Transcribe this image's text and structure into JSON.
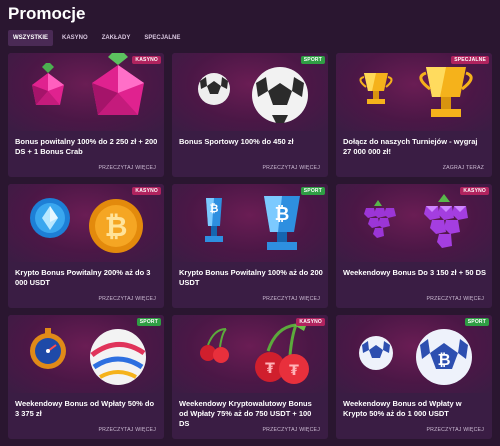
{
  "page": {
    "title": "Promocje"
  },
  "tabs": [
    {
      "label": "WSZYSTKIE",
      "active": true
    },
    {
      "label": "KASYNO",
      "active": false
    },
    {
      "label": "ZAKŁADY",
      "active": false
    },
    {
      "label": "SPECJALNE",
      "active": false
    }
  ],
  "colors": {
    "badge_kasyno": "#b0235e",
    "badge_sport": "#2f9e44",
    "badge_specjalne": "#b0235e"
  },
  "cards": [
    {
      "title": "Bonus powitalny 100% do 2 250 zł + 200 DS + 1 Bonus Crab",
      "badge": "KASYNO",
      "badge_type": "kasyno",
      "link": "PRZECZYTAJ WIĘCEJ",
      "art": "raspberry-icon"
    },
    {
      "title": "Bonus Sportowy 100% do 450 zł",
      "badge": "SPORT",
      "badge_type": "sport",
      "link": "PRZECZYTAJ WIĘCEJ",
      "art": "soccer-ball-icon"
    },
    {
      "title": "Dołącz do naszych Turniejów - wygraj 27 000 000 zł!",
      "badge": "SPECJALNE",
      "badge_type": "specjalne",
      "link": "ZAGRAJ TERAZ",
      "art": "trophy-icon"
    },
    {
      "title": "Krypto Bonus Powitalny 200% aż do 3 000 USDT",
      "badge": "KASYNO",
      "badge_type": "kasyno",
      "link": "PRZECZYTAJ WIĘCEJ",
      "art": "crypto-coin-icon"
    },
    {
      "title": "Krypto Bonus Powitalny 100% aż do 200 USDT",
      "badge": "SPORT",
      "badge_type": "sport",
      "link": "PRZECZYTAJ WIĘCEJ",
      "art": "bitcoin-trophy-icon"
    },
    {
      "title": "Weekendowy Bonus Do 3 150 zł + 50 DS",
      "badge": "KASYNO",
      "badge_type": "kasyno",
      "link": "PRZECZYTAJ WIĘCEJ",
      "art": "grapes-icon"
    },
    {
      "title": "Weekendowy Bonus od Wpłaty 50% do 3 375 zł",
      "badge": "SPORT",
      "badge_type": "sport",
      "link": "PRZECZYTAJ WIĘCEJ",
      "art": "stopwatch-ball-icon"
    },
    {
      "title": "Weekendowy Kryptowalutowy Bonus od Wpłaty 75% aż do 750 USDT + 100 DS",
      "badge": "KASYNO",
      "badge_type": "kasyno",
      "link": "PRZECZYTAJ WIĘCEJ",
      "art": "cherries-icon"
    },
    {
      "title": "Weekendowy Bonus od Wpłaty w Krypto 50% aż do 1 000 USDT",
      "badge": "SPORT",
      "badge_type": "sport",
      "link": "PRZECZYTAJ WIĘCEJ",
      "art": "bitcoin-ball-icon"
    }
  ]
}
